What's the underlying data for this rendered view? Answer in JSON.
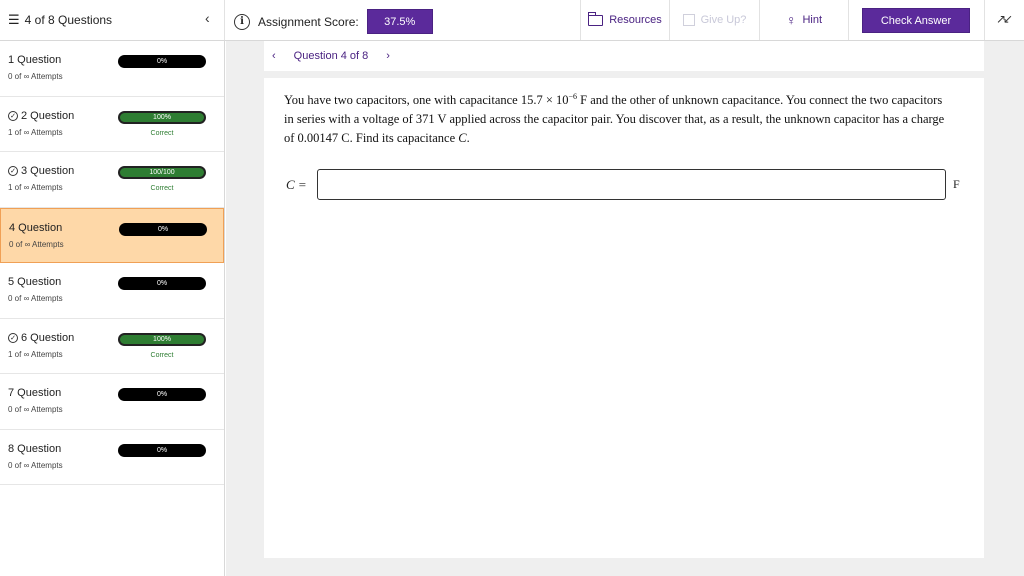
{
  "topbar": {
    "question_counter": "4 of 8 Questions",
    "collapse": "‹",
    "score_label": "Assignment Score:",
    "score_value": "37.5%",
    "resources_label": "Resources",
    "giveup_label": "Give Up?",
    "hint_label": "Hint",
    "check_answer_label": "Check Answer"
  },
  "sidebar": {
    "items": [
      {
        "title": "1 Question",
        "attempts": "0 of ∞ Attempts",
        "bar": "0%",
        "status": "",
        "done": false,
        "active": false
      },
      {
        "title": "2 Question",
        "attempts": "1 of ∞ Attempts",
        "bar": "100%",
        "status": "Correct",
        "done": true,
        "active": false
      },
      {
        "title": "3 Question",
        "attempts": "1 of ∞ Attempts",
        "bar": "100/100",
        "status": "Correct",
        "done": true,
        "active": false
      },
      {
        "title": "4 Question",
        "attempts": "0 of ∞ Attempts",
        "bar": "0%",
        "status": "",
        "done": false,
        "active": true
      },
      {
        "title": "5 Question",
        "attempts": "0 of ∞ Attempts",
        "bar": "0%",
        "status": "",
        "done": false,
        "active": false
      },
      {
        "title": "6 Question",
        "attempts": "1 of ∞ Attempts",
        "bar": "100%",
        "status": "Correct",
        "done": true,
        "active": false
      },
      {
        "title": "7 Question",
        "attempts": "0 of ∞ Attempts",
        "bar": "0%",
        "status": "",
        "done": false,
        "active": false
      },
      {
        "title": "8 Question",
        "attempts": "0 of ∞ Attempts",
        "bar": "0%",
        "status": "",
        "done": false,
        "active": false
      }
    ]
  },
  "main": {
    "nav_prev": "‹",
    "nav_label": "Question 4 of 8",
    "nav_next": "›",
    "question": {
      "part1": "You have two capacitors, one with capacitance 15.7 × 10",
      "exponent": "−6",
      "part2": " F and the other of unknown capacitance. You connect the two capacitors in series with a voltage of 371 V applied across the capacitor pair. You discover that, as a result, the unknown capacitor has a charge of 0.00147 C. Find its capacitance ",
      "var": "C",
      "end": "."
    },
    "answer_label": "C =",
    "answer_value": "",
    "unit": "F"
  }
}
